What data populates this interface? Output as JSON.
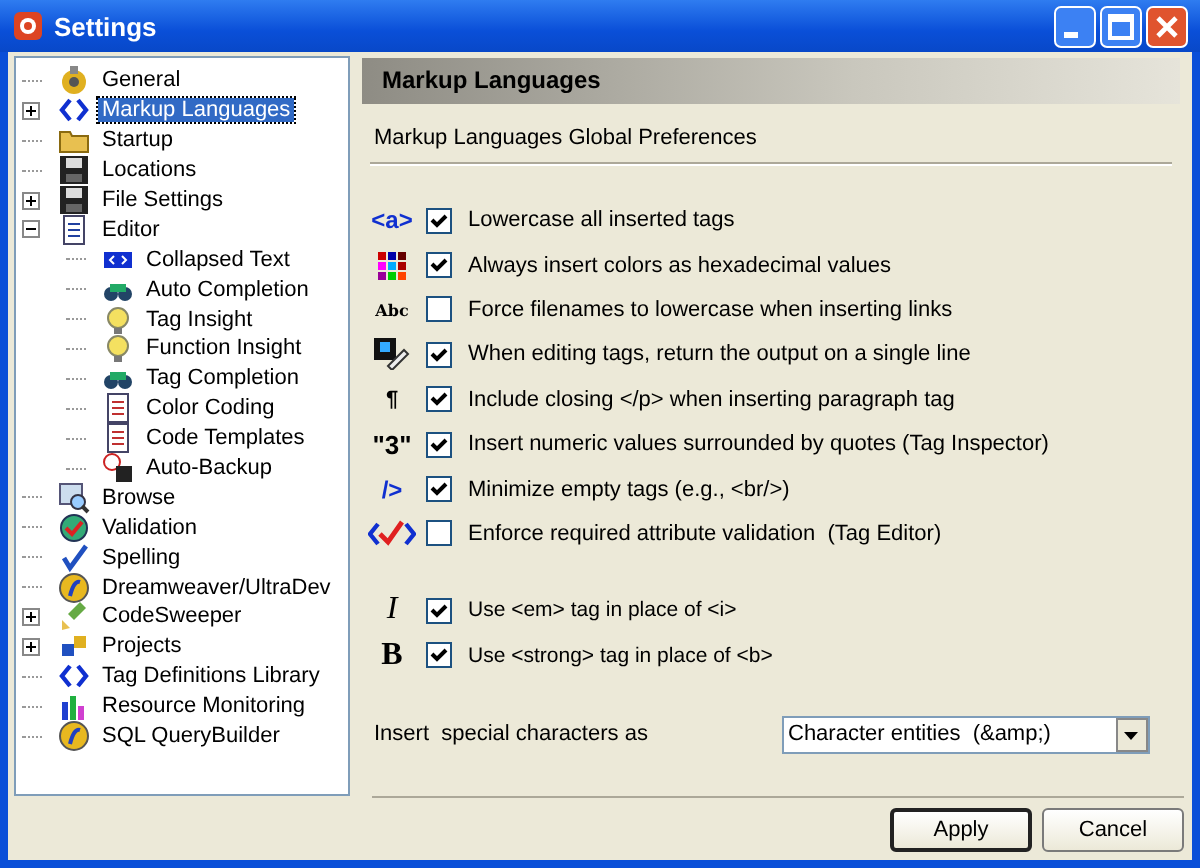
{
  "window": {
    "title": "Settings"
  },
  "tree": [
    {
      "label": "General",
      "selected": false
    },
    {
      "label": "Markup Languages",
      "selected": true,
      "expanded": false
    },
    {
      "label": "Startup",
      "selected": false
    },
    {
      "label": "Locations",
      "selected": false
    },
    {
      "label": "File Settings",
      "selected": false,
      "expanded": false
    },
    {
      "label": "Editor",
      "selected": false,
      "expanded": true,
      "children": [
        {
          "label": "Collapsed Text",
          "selected": false
        },
        {
          "label": "Auto Completion",
          "selected": false
        },
        {
          "label": "Tag Insight",
          "selected": false
        },
        {
          "label": "Function Insight",
          "selected": false
        },
        {
          "label": "Tag Completion",
          "selected": false
        },
        {
          "label": "Color Coding",
          "selected": false
        },
        {
          "label": "Code Templates",
          "selected": false
        },
        {
          "label": "Auto-Backup",
          "selected": false
        }
      ]
    },
    {
      "label": "Browse",
      "selected": false
    },
    {
      "label": "Validation",
      "selected": false
    },
    {
      "label": "Spelling",
      "selected": false
    },
    {
      "label": "Dreamweaver/UltraDev",
      "selected": false
    },
    {
      "label": "CodeSweeper",
      "selected": false,
      "expanded": false
    },
    {
      "label": "Projects",
      "selected": false,
      "expanded": false
    },
    {
      "label": "Tag Definitions Library",
      "selected": false
    },
    {
      "label": "Resource Monitoring",
      "selected": false
    },
    {
      "label": "SQL QueryBuilder",
      "selected": false
    }
  ],
  "panel": {
    "header": "Markup Languages",
    "subtitle": "Markup Languages Global Preferences"
  },
  "options": [
    {
      "glyph": "<a>",
      "label": "Lowercase all inserted tags",
      "checked": true
    },
    {
      "label": "Always insert colors as hexadecimal values",
      "checked": true
    },
    {
      "glyph": "Abc",
      "label": "Force filenames to lowercase when inserting links",
      "checked": false
    },
    {
      "label": "When editing tags, return the output on a single line",
      "checked": true
    },
    {
      "glyph": "¶",
      "label": "Include closing </p> when inserting paragraph tag",
      "checked": true
    },
    {
      "glyph": "\"3\"",
      "label": "Insert numeric values surrounded by quotes (Tag Inspector)",
      "checked": true
    },
    {
      "glyph": "/>",
      "label": "Minimize empty tags (e.g., <br/>)",
      "checked": true
    },
    {
      "label": "Enforce required attribute validation  (Tag Editor)",
      "checked": false
    }
  ],
  "tag_options": [
    {
      "glyph": "I",
      "label": "Use <em> tag in place of <i>",
      "checked": true
    },
    {
      "glyph": "B",
      "label": "Use <strong> tag in place of <b>",
      "checked": true
    }
  ],
  "special_chars": {
    "label": "Insert  special characters as",
    "value": "Character entities  (&amp;)"
  },
  "buttons": [
    {
      "label": "Apply",
      "default": true
    },
    {
      "label": "Cancel",
      "default": false
    }
  ]
}
